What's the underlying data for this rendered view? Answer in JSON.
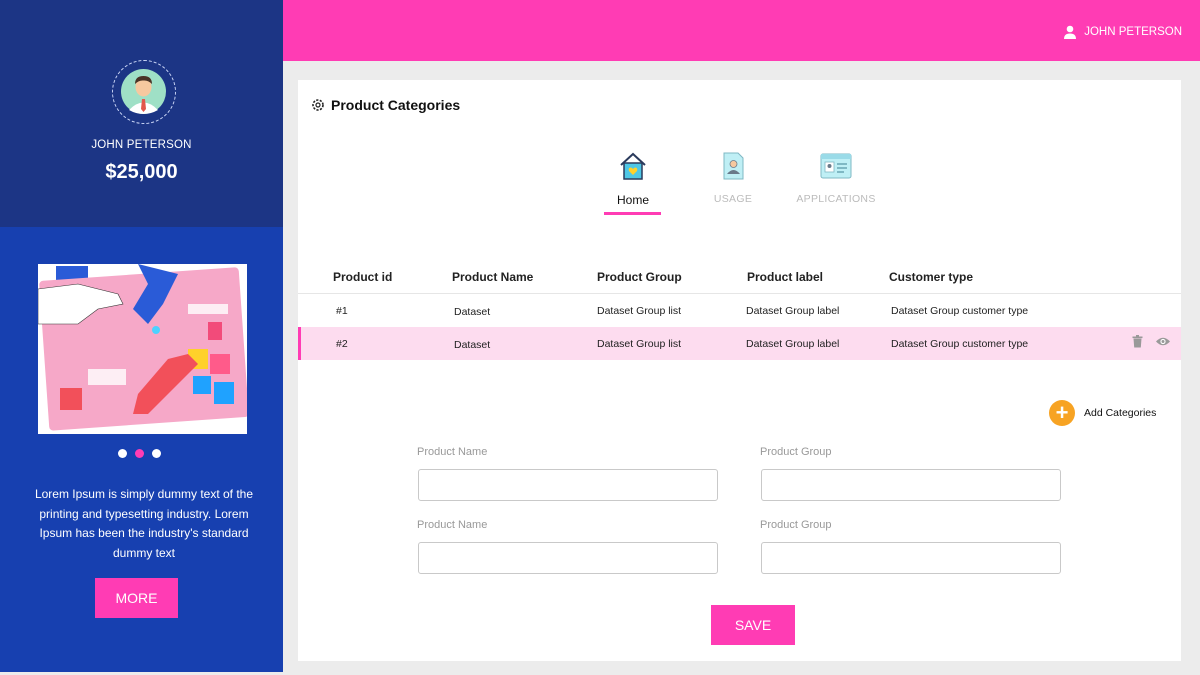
{
  "profile": {
    "name": "JOHN PETERSON",
    "amount": "$25,000"
  },
  "topbar": {
    "user_name": "JOHN PETERSON",
    "user_icon": "user-icon"
  },
  "promo": {
    "text": "Lorem Ipsum is simply dummy text of the printing and typesetting industry. Lorem Ipsum has been the industry's standard dummy text",
    "more_label": "MORE",
    "active_slide": 2,
    "slide_count": 3
  },
  "card": {
    "title": "Product Categories",
    "title_icon": "gear-icon",
    "tabs": [
      {
        "label": "Home",
        "icon": "home-icon",
        "active": true
      },
      {
        "label": "USAGE",
        "icon": "document-user-icon",
        "active": false
      },
      {
        "label": "APPLICATIONS",
        "icon": "browser-window-icon",
        "active": false
      }
    ]
  },
  "table": {
    "columns": [
      "Product id",
      "Product Name",
      "Product Group",
      "Product label",
      "Customer type"
    ],
    "rows": [
      [
        "#1",
        "Dataset",
        "Dataset  Group list",
        "Dataset  Group label",
        "Dataset  Group customer type"
      ],
      [
        "#2",
        "Dataset",
        "Dataset  Group list",
        "Dataset  Group label",
        "Dataset  Group customer type"
      ]
    ],
    "selected_row": 2
  },
  "add_categories_label": "Add Categories",
  "form": {
    "fields": [
      {
        "label": "Product Name",
        "value": ""
      },
      {
        "label": "Product Group",
        "value": ""
      },
      {
        "label": "Product Name",
        "value": ""
      },
      {
        "label": "Product Group",
        "value": ""
      }
    ],
    "save_label": "SAVE"
  },
  "colors": {
    "accent": "#ff3cb4",
    "sidebar": "#1740b0",
    "profile_bg": "#1c3585",
    "add_button": "#f7a323"
  }
}
